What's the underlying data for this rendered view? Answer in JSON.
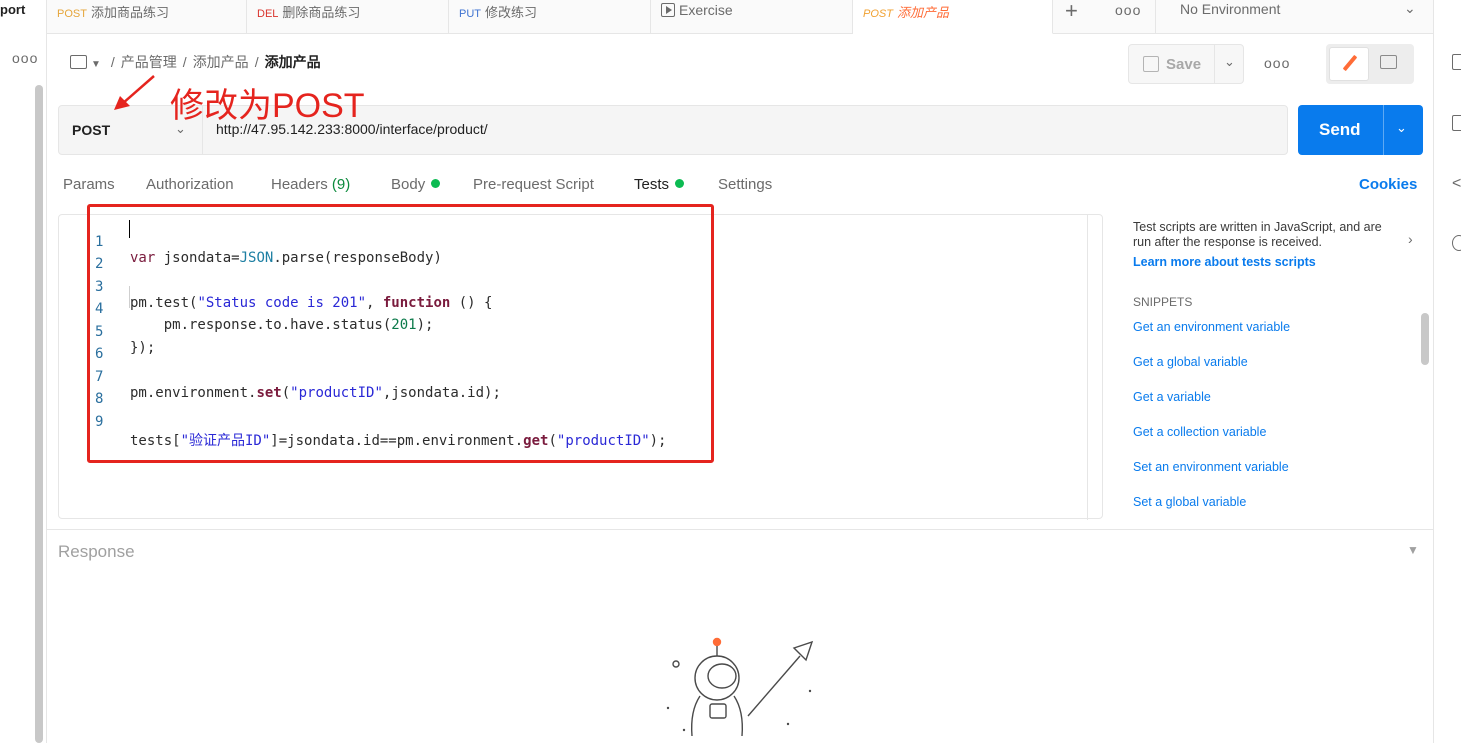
{
  "left_strip": {
    "label": "port",
    "more": "ooo"
  },
  "tabs": [
    {
      "method": "POST",
      "title": "添加商品练习"
    },
    {
      "method": "DEL",
      "title": "删除商品练习"
    },
    {
      "method": "PUT",
      "title": "修改练习"
    },
    {
      "method": "",
      "title": "Exercise"
    },
    {
      "method": "POST",
      "title": "添加产品"
    }
  ],
  "tabs_bar": {
    "add": "+",
    "more": "ooo",
    "environment": "No Environment"
  },
  "breadcrumb": {
    "parts": [
      "产品管理",
      "添加产品"
    ],
    "current": "添加产品",
    "sep": "/"
  },
  "header": {
    "save_label": "Save",
    "more": "ooo"
  },
  "request": {
    "method": "POST",
    "url": "http://47.95.142.233:8000/interface/product/",
    "send_label": "Send"
  },
  "annotation": {
    "text": "修改为POST",
    "color": "#e5241e"
  },
  "request_tabs": {
    "params": "Params",
    "authorization": "Authorization",
    "headers": "Headers",
    "headers_count": "(9)",
    "body": "Body",
    "prerequest": "Pre-request Script",
    "tests": "Tests",
    "settings": "Settings",
    "cookies": "Cookies"
  },
  "editor": {
    "line_numbers": [
      "1",
      "2",
      "3",
      "4",
      "5",
      "6",
      "7",
      "8",
      "9"
    ],
    "lines": [
      "var jsondata=JSON.parse(responseBody)",
      "",
      "pm.test(\"Status code is 201\", function () {",
      "    pm.response.to.have.status(201);",
      "});",
      "",
      "pm.environment.set(\"productID\",jsondata.id);",
      "",
      "tests[\"验证产品ID\"]=jsondata.id==pm.environment.get(\"productID\");"
    ]
  },
  "snippets": {
    "description": "Test scripts are written in JavaScript, and are run after the response is received.",
    "learn_more": "Learn more about tests scripts",
    "heading": "SNIPPETS",
    "items": [
      "Get an environment variable",
      "Get a global variable",
      "Get a variable",
      "Get a collection variable",
      "Set an environment variable",
      "Set a global variable"
    ]
  },
  "response": {
    "title": "Response"
  },
  "colors": {
    "accent": "#ff6c37",
    "send": "#097bed",
    "link": "#097bed",
    "dot": "#0cbb52"
  }
}
